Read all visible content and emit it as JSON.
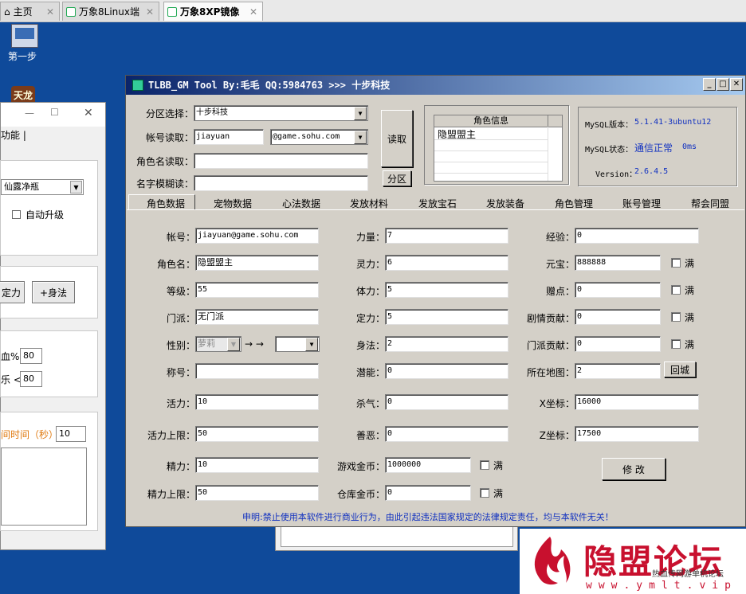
{
  "browser_tabs": [
    {
      "label": "主页"
    },
    {
      "label": "万象8Linux端"
    },
    {
      "label": "万象8XP镜像"
    }
  ],
  "desktop": {
    "icon1_label": "第一步",
    "icon2_label": "天龙"
  },
  "left_window": {
    "tab_label": "功能 |",
    "dropdown_value": "仙露净瓶",
    "auto_upgrade_label": "自动升级",
    "btn1_label": "定力",
    "btn2_label": "+身法",
    "row1_label": "血%",
    "row1_value": "80",
    "row2_label": "乐 <",
    "row2_value": "80",
    "time_label": "间时间（秒）",
    "time_value": "10"
  },
  "main": {
    "title": "TLBB_GM Tool By:毛毛 QQ:5984763 >>> 十步科技",
    "zone_label": "分区选择：",
    "zone_value": "十步科技",
    "account_label": "帐号读取：",
    "account_value": "jiayuan",
    "domain_value": "@game.sohu.com",
    "rolename_label": "角色名读取：",
    "rolename_value": "",
    "fuzzy_label": "名字模糊读：",
    "fuzzy_value": "",
    "read_button": "读取",
    "zone_button": "分区",
    "role_info_header": "角色信息",
    "role_info_rows": [
      "隐盟盟主",
      "",
      "",
      "",
      "",
      ""
    ],
    "mysql_version_label": "MySQL版本：",
    "mysql_version_value": "5.1.41-3ubuntu12",
    "mysql_status_label": "MySQL状态：",
    "mysql_status_value": "通信正常",
    "mysql_latency": "0ms",
    "version_label": "Version：",
    "version_value": "2.6.4.5",
    "tabs": [
      "角色数据",
      "宠物数据",
      "心法数据",
      "发放材料",
      "发放宝石",
      "发放装备",
      "角色管理",
      "账号管理",
      "帮会同盟"
    ],
    "fields": {
      "account": {
        "label": "帐号：",
        "value": "jiayuan@game.sohu.com"
      },
      "rolename": {
        "label": "角色名：",
        "value": "隐盟盟主"
      },
      "level": {
        "label": "等级：",
        "value": "55"
      },
      "school": {
        "label": "门派：",
        "value": "无门派"
      },
      "gender": {
        "label": "性别：",
        "value": "萝莉",
        "arrows": "→ →",
        "target": ""
      },
      "nickname": {
        "label": "称号：",
        "value": ""
      },
      "vitality": {
        "label": "活力：",
        "value": "10"
      },
      "vitality_max": {
        "label": "活力上限：",
        "value": "50"
      },
      "energy": {
        "label": "精力：",
        "value": "10"
      },
      "energy_max": {
        "label": "精力上限：",
        "value": "50"
      },
      "strength": {
        "label": "力量：",
        "value": "7"
      },
      "spirit": {
        "label": "灵力：",
        "value": "6"
      },
      "stamina": {
        "label": "体力：",
        "value": "5"
      },
      "focus": {
        "label": "定力：",
        "value": "5"
      },
      "agility": {
        "label": "身法：",
        "value": "2"
      },
      "potential": {
        "label": "潜能：",
        "value": "0"
      },
      "kill": {
        "label": "杀气：",
        "value": "0"
      },
      "karma": {
        "label": "善恶：",
        "value": "0"
      },
      "game_gold": {
        "label": "游戏金币：",
        "value": "1000000",
        "max_label": "满"
      },
      "bank_gold": {
        "label": "仓库金币：",
        "value": "0",
        "max_label": "满"
      },
      "exp": {
        "label": "经验：",
        "value": "0"
      },
      "yuanbao": {
        "label": "元宝：",
        "value": "888888",
        "max_label": "满"
      },
      "gift_points": {
        "label": "赠点：",
        "value": "0",
        "max_label": "满"
      },
      "plot_contrib": {
        "label": "剧情贡献：",
        "value": "0",
        "max_label": "满"
      },
      "school_contrib": {
        "label": "门派贡献：",
        "value": "0",
        "max_label": "满"
      },
      "map": {
        "label": "所在地图：",
        "value": "2",
        "button": "回城"
      },
      "x_coord": {
        "label": "X坐标：",
        "value": "16000"
      },
      "z_coord": {
        "label": "Z坐标：",
        "value": "17500"
      }
    },
    "modify_button": "修 改",
    "notice": "申明:禁止使用本软件进行商业行为，由此引起违法国家规定的法律规定责任，均与本软件无关！"
  },
  "watermark": {
    "brand": "隐盟论坛",
    "sub": "热血传网游单机论坛",
    "url": "www.ymlt.vip"
  }
}
